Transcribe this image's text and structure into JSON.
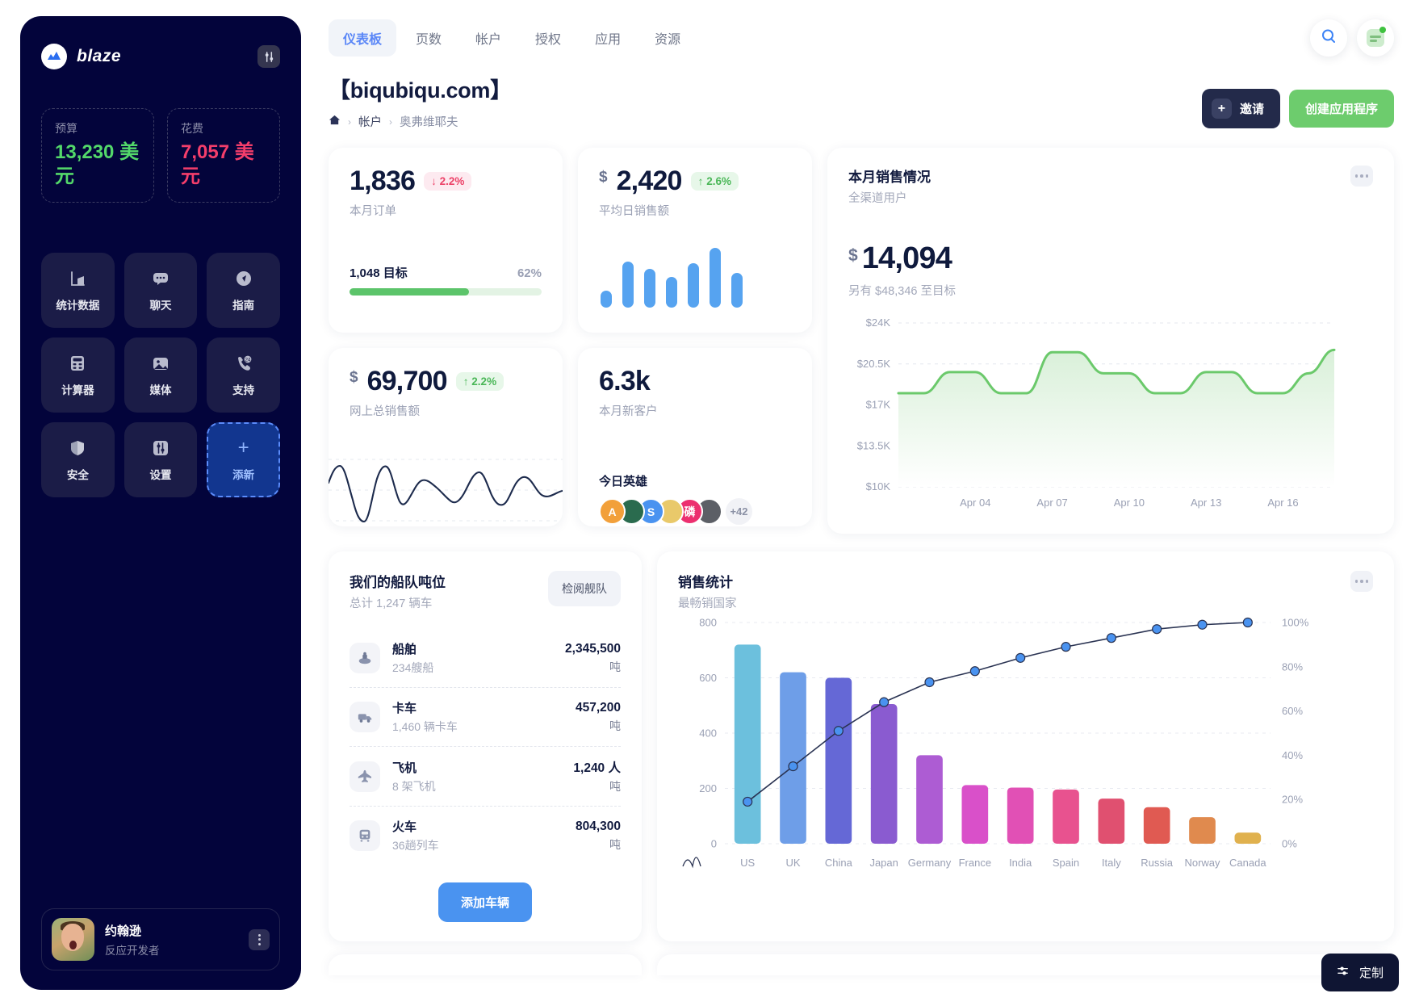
{
  "sidebar": {
    "brand": "blaze",
    "settings_icon": "sliders-icon",
    "kpis": [
      {
        "label": "预算",
        "value": "13,230 美元",
        "color": "#53d86a"
      },
      {
        "label": "花费",
        "value": "7,057 美元",
        "color": "#f43e6b"
      }
    ],
    "tiles": [
      {
        "label": "统计数据",
        "icon": "bar-chart-icon"
      },
      {
        "label": "聊天",
        "icon": "chat-bubble-icon"
      },
      {
        "label": "指南",
        "icon": "compass-icon"
      },
      {
        "label": "计算器",
        "icon": "calculator-icon"
      },
      {
        "label": "媒体",
        "icon": "image-icon"
      },
      {
        "label": "支持",
        "icon": "phone-24-icon"
      },
      {
        "label": "安全",
        "icon": "shield-icon"
      },
      {
        "label": "设置",
        "icon": "sliders-icon"
      },
      {
        "label": "添新",
        "icon": "plus-icon"
      }
    ],
    "profile": {
      "name": "约翰逊",
      "role": "反应开发者"
    }
  },
  "topbar": {
    "tabs": [
      {
        "label": "仪表板",
        "active": true
      },
      {
        "label": "页数",
        "active": false
      },
      {
        "label": "帐户",
        "active": false
      },
      {
        "label": "授权",
        "active": false
      },
      {
        "label": "应用",
        "active": false
      },
      {
        "label": "资源",
        "active": false
      }
    ],
    "search_icon": "search-icon",
    "notifications_icon": "notification-icon"
  },
  "header": {
    "title": "【biqubiqu.com】",
    "breadcrumb": {
      "home_icon": "home-icon",
      "items": [
        "帐户",
        "奥弗维耶夫"
      ]
    },
    "invite_label": "邀请",
    "create_app_label": "创建应用程序"
  },
  "cards": {
    "orders": {
      "value": "1,836",
      "change": "2.2%",
      "change_dir": "down",
      "subtitle": "本月订单",
      "goal_label": "1,048 目标",
      "goal_pct": "62%",
      "goal_fill": 62
    },
    "avg_daily": {
      "currency": "$",
      "value": "2,420",
      "change": "2.6%",
      "change_dir": "up",
      "subtitle": "平均日销售额"
    },
    "online_total": {
      "currency": "$",
      "value": "69,700",
      "change": "2.2%",
      "change_dir": "up",
      "subtitle": "网上总销售额"
    },
    "new_customers": {
      "value": "6.3k",
      "subtitle": "本月新客户",
      "heroes_title": "今日英雄",
      "heroes_more": "+42",
      "heroes": [
        {
          "initial": "A",
          "color": "#f2a03a"
        },
        {
          "initial": "",
          "color": "#2a6b4e"
        },
        {
          "initial": "S",
          "color": "#4a93f0"
        },
        {
          "initial": "",
          "color": "#e9c96a"
        },
        {
          "initial": "磷",
          "color": "#ec2f6f"
        },
        {
          "initial": "",
          "color": "#5c5f66"
        }
      ]
    },
    "month_sales": {
      "title": "本月销售情况",
      "subtitle": "全渠道用户",
      "currency": "$",
      "value": "14,094",
      "goal_note": "另有 $48,346 至目标",
      "menu_icon": "more-dots-icon"
    },
    "fleet": {
      "title": "我们的船队吨位",
      "subtitle": "总计 1,247 辆车",
      "review_label": "检阅舰队",
      "add_label": "添加车辆",
      "rows": [
        {
          "icon": "ship-icon",
          "name": "船舶",
          "desc": "234艘船",
          "amount": "2,345,500",
          "unit": "吨"
        },
        {
          "icon": "truck-icon",
          "name": "卡车",
          "desc": "1,460 辆卡车",
          "amount": "457,200",
          "unit": "吨"
        },
        {
          "icon": "plane-icon",
          "name": "飞机",
          "desc": "8 架飞机",
          "amount": "1,240 人",
          "unit": "吨"
        },
        {
          "icon": "train-icon",
          "name": "火车",
          "desc": "36趟列车",
          "amount": "804,300",
          "unit": "吨"
        }
      ]
    },
    "sales_stats": {
      "title": "销售统计",
      "subtitle": "最畅销国家",
      "menu_icon": "more-dots-icon",
      "legend_icon": "distribution-icon"
    }
  },
  "customize": {
    "label": "定制",
    "icon": "sliders-icon"
  },
  "chart_data": [
    {
      "type": "area",
      "title": "本月销售情况",
      "subtitle": "全渠道用户",
      "x": [
        "Apr 01",
        "Apr 02",
        "Apr 03",
        "Apr 04",
        "Apr 05",
        "Apr 06",
        "Apr 07",
        "Apr 08",
        "Apr 09",
        "Apr 10",
        "Apr 11",
        "Apr 12",
        "Apr 13",
        "Apr 14",
        "Apr 15",
        "Apr 16",
        "Apr 17",
        "Apr 18"
      ],
      "xtick_labels": [
        "Apr 04",
        "Apr 07",
        "Apr 10",
        "Apr 13",
        "Apr 16"
      ],
      "values": [
        18000,
        18000,
        19800,
        19800,
        18000,
        18000,
        21500,
        21500,
        19700,
        19700,
        18000,
        18000,
        19800,
        19800,
        18000,
        18000,
        19700,
        21700
      ],
      "ytick_labels": [
        "$24K",
        "$20.5K",
        "$17K",
        "$13.5K",
        "$10K"
      ],
      "ylim": [
        10000,
        24000
      ],
      "line_color": "#6bc96b",
      "fill_color": "#e9f7e9",
      "grid": true,
      "legend": "none"
    },
    {
      "type": "bar",
      "title": "销售统计",
      "subtitle": "最畅销国家",
      "categories": [
        "US",
        "UK",
        "China",
        "Japan",
        "Germany",
        "France",
        "India",
        "Spain",
        "Italy",
        "Russia",
        "Norway",
        "Canada"
      ],
      "values": [
        720,
        620,
        600,
        505,
        320,
        212,
        203,
        196,
        163,
        132,
        96,
        40
      ],
      "bar_colors": [
        "#6cc0dd",
        "#6e9ee8",
        "#6568d6",
        "#8a5bd0",
        "#ad5cd3",
        "#d950c9",
        "#e150b5",
        "#e8528f",
        "#e05070",
        "#e05a52",
        "#e08a4e",
        "#e0b14e"
      ],
      "cumulative_percent": [
        19,
        35,
        51,
        64,
        73,
        78,
        84,
        89,
        93,
        97,
        99,
        100
      ],
      "line_color": "#2a3352",
      "point_color": "#4a93f0",
      "ylim": [
        0,
        800
      ],
      "ytick_labels": [
        "0",
        "200",
        "400",
        "600",
        "800"
      ],
      "y2lim": [
        0,
        100
      ],
      "y2tick_labels": [
        "0%",
        "20%",
        "40%",
        "60%",
        "80%",
        "100%"
      ],
      "grid": true,
      "legend": "none"
    },
    {
      "type": "bar",
      "title": "平均日销售额",
      "categories": [
        "1",
        "2",
        "3",
        "4",
        "5",
        "6",
        "7"
      ],
      "values": [
        22,
        60,
        50,
        40,
        58,
        78,
        45
      ],
      "bar_color": "#56a3f0",
      "ylim": [
        0,
        80
      ],
      "grid": false,
      "legend": "none"
    },
    {
      "type": "line",
      "title": "网上总销售额",
      "x": [
        0,
        1,
        2,
        3,
        4,
        5,
        6,
        7,
        8,
        9,
        10,
        11,
        12,
        13,
        14,
        15,
        16,
        17,
        18,
        19,
        20
      ],
      "values": [
        56,
        74,
        30,
        5,
        46,
        78,
        34,
        42,
        66,
        62,
        55,
        38,
        44,
        72,
        40,
        46,
        68,
        58,
        50,
        56,
        54
      ],
      "line_color": "#1d2b4d",
      "grid": true,
      "legend": "none"
    }
  ]
}
